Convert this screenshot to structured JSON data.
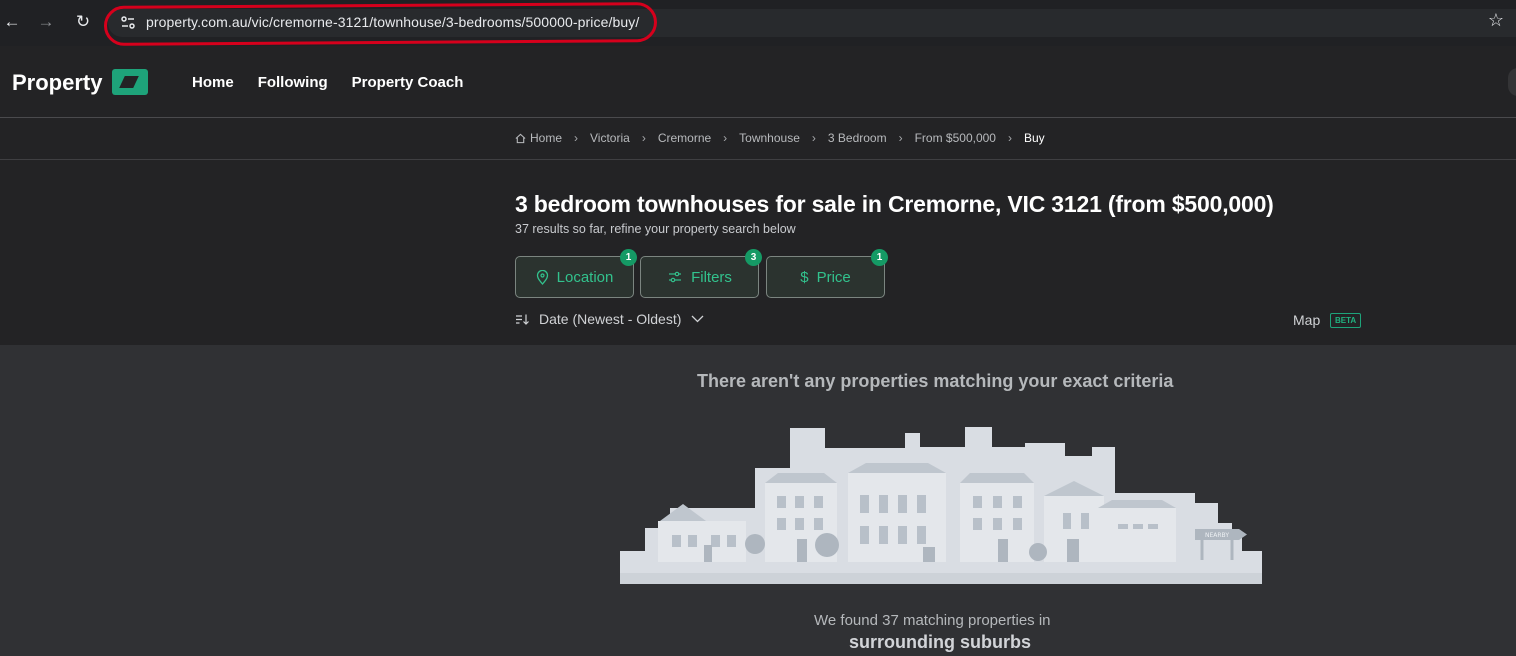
{
  "browser": {
    "url": "property.com.au/vic/cremorne-3121/townhouse/3-bedrooms/500000-price/buy/"
  },
  "header": {
    "logo": "Property",
    "nav": [
      "Home",
      "Following",
      "Property Coach"
    ]
  },
  "breadcrumb": [
    "Home",
    "Victoria",
    "Cremorne",
    "Townhouse",
    "3 Bedroom",
    "From $500,000",
    "Buy"
  ],
  "search": {
    "title": "3 bedroom townhouses for sale in Cremorne, VIC 3121 (from $500,000)",
    "subtitle": "37 results so far, refine your property search below",
    "filters": [
      {
        "label": "Location",
        "count": "1"
      },
      {
        "label": "Filters",
        "count": "3"
      },
      {
        "label": "Price",
        "count": "1"
      }
    ],
    "sort": "Date (Newest - Oldest)",
    "map": "Map",
    "beta": "BETA"
  },
  "empty_state": {
    "heading": "There aren't any properties matching your exact criteria",
    "sign": "NEARBY",
    "found_text": "We found 37 matching properties in",
    "surrounding": "surrounding suburbs"
  },
  "colors": {
    "accent": "#1ea37a",
    "badge": "#159a65",
    "background": "#303134",
    "header": "#232325"
  }
}
